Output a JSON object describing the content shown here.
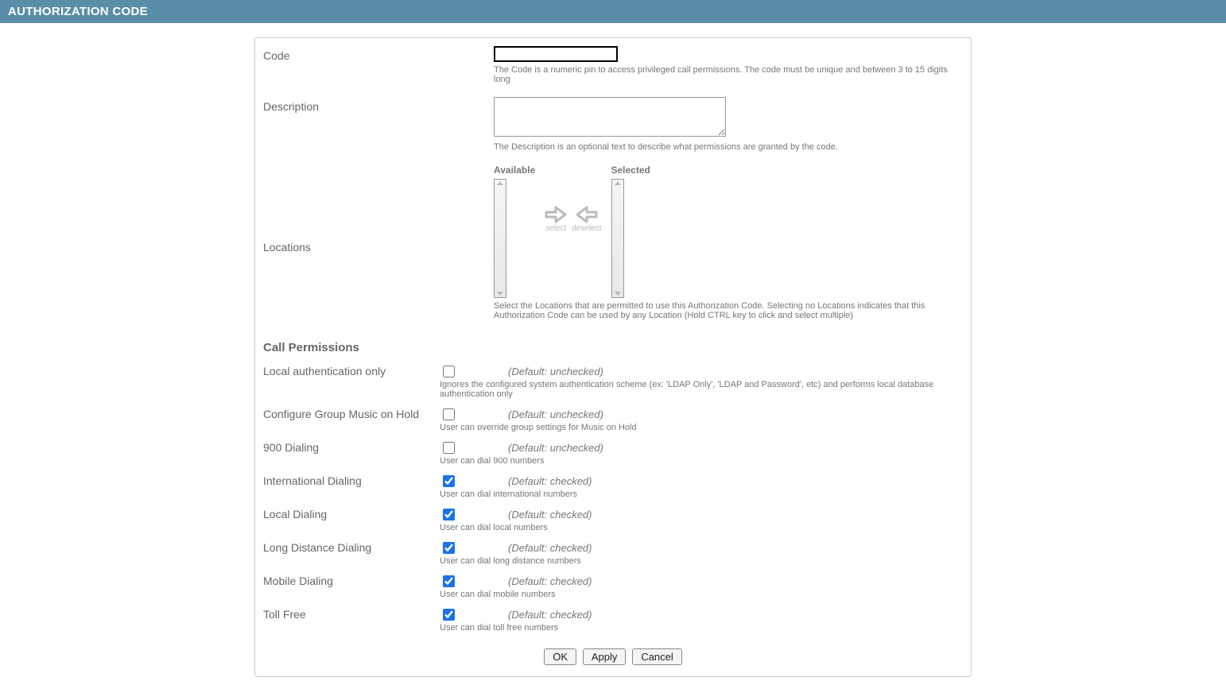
{
  "header": {
    "title": "AUTHORIZATION CODE"
  },
  "form": {
    "code": {
      "label": "Code",
      "value": "",
      "help": "The Code is a numeric pin to access privileged call permissions. The code must be unique and between 3 to 15 digits long"
    },
    "description": {
      "label": "Description",
      "value": "",
      "help": "The Description is an optional text to describe what permissions are granted by the code."
    },
    "locations": {
      "label": "Locations",
      "available_label": "Available",
      "selected_label": "Selected",
      "select_label": "select",
      "deselect_label": "deselect",
      "help": "Select the Locations that are permitted to use this Authorization Code. Selecting no Locations indicates that this Authorization Code can be used by any Location (Hold CTRL key to click and select multiple)"
    }
  },
  "permissions": {
    "title": "Call Permissions",
    "items": [
      {
        "label": "Local authentication only",
        "checked": false,
        "default": "(Default: unchecked)",
        "help": "Ignores the configured system authentication scheme (ex: 'LDAP Only', 'LDAP and Password', etc) and performs local database authentication only"
      },
      {
        "label": "Configure Group Music on Hold",
        "checked": false,
        "default": "(Default: unchecked)",
        "help": "User can override group settings for Music on Hold"
      },
      {
        "label": "900 Dialing",
        "checked": false,
        "default": "(Default: unchecked)",
        "help": "User can dial 900 numbers"
      },
      {
        "label": "International Dialing",
        "checked": true,
        "default": "(Default: checked)",
        "help": "User can dial international numbers"
      },
      {
        "label": "Local Dialing",
        "checked": true,
        "default": "(Default: checked)",
        "help": "User can dial local numbers"
      },
      {
        "label": "Long Distance Dialing",
        "checked": true,
        "default": "(Default: checked)",
        "help": "User can dial long distance numbers"
      },
      {
        "label": "Mobile Dialing",
        "checked": true,
        "default": "(Default: checked)",
        "help": "User can dial mobile numbers"
      },
      {
        "label": "Toll Free",
        "checked": true,
        "default": "(Default: checked)",
        "help": "User can dial toll free numbers"
      }
    ]
  },
  "buttons": {
    "ok": "OK",
    "apply": "Apply",
    "cancel": "Cancel"
  }
}
